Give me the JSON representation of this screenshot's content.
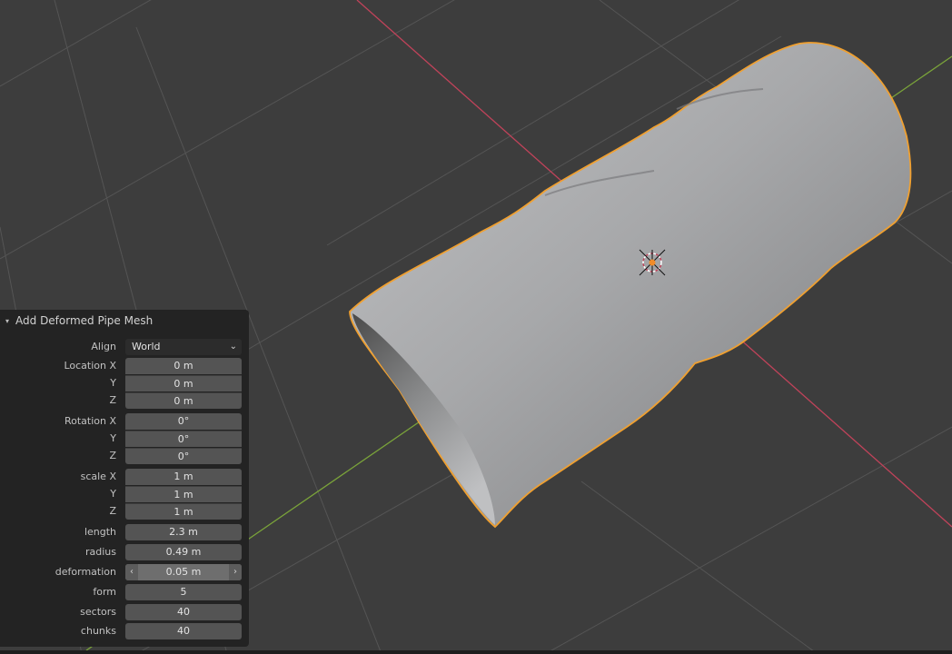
{
  "viewport": {
    "background_color": "#3d3d3d",
    "grid_color": "#555555",
    "x_axis_color": "#c0435a",
    "y_axis_color": "#7aa33a",
    "selection_outline_color": "#f0a030",
    "object": "deformed-pipe-mesh",
    "origin_marker": "3d-cursor-icon"
  },
  "panel": {
    "title": "Add Deformed Pipe Mesh",
    "collapse_icon": "▾",
    "align": {
      "label": "Align",
      "value": "World"
    },
    "location": {
      "label_x": "Location X",
      "label_y": "Y",
      "label_z": "Z",
      "x": "0 m",
      "y": "0 m",
      "z": "0 m"
    },
    "rotation": {
      "label_x": "Rotation X",
      "label_y": "Y",
      "label_z": "Z",
      "x": "0°",
      "y": "0°",
      "z": "0°"
    },
    "scale": {
      "label_x": "scale X",
      "label_y": "Y",
      "label_z": "Z",
      "x": "1 m",
      "y": "1 m",
      "z": "1 m"
    },
    "length": {
      "label": "length",
      "value": "2.3 m"
    },
    "radius": {
      "label": "radius",
      "value": "0.49 m"
    },
    "deformation": {
      "label": "deformation",
      "value": "0.05 m",
      "left_arrow": "‹",
      "right_arrow": "›"
    },
    "form": {
      "label": "form",
      "value": "5"
    },
    "sectors": {
      "label": "sectors",
      "value": "40"
    },
    "chunks": {
      "label": "chunks",
      "value": "40"
    }
  }
}
